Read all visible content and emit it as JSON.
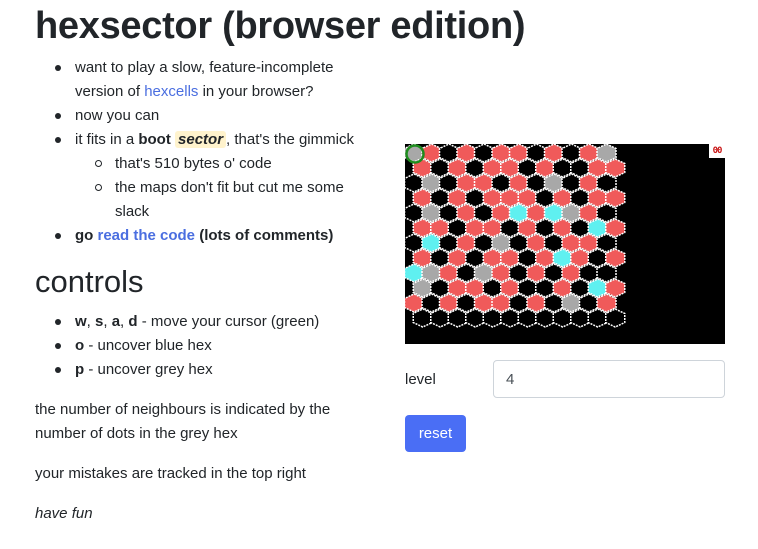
{
  "title": "hexsector (browser edition)",
  "intro": {
    "item1": {
      "before": "want to play a slow, feature-incomplete version of ",
      "link": "hexcells",
      "after": " in your browser?"
    },
    "item2": "now you can",
    "item3": {
      "before": "it fits in a ",
      "bold": "boot",
      "code": "sector",
      "after": ", that's the gimmick",
      "sub": [
        "that's 510 bytes o' code",
        "the maps don't fit but cut me some slack"
      ]
    },
    "item4": {
      "bold1": "go ",
      "link": "read the code",
      "bold2": " (lots of comments)"
    }
  },
  "controls": {
    "heading": "controls",
    "keys_move": {
      "w": "w",
      "s": "s",
      "a": "a",
      "d": "d",
      "sep": ", ",
      "desc": " - move your cursor (green)"
    },
    "key_o": {
      "key": "o",
      "desc": " - uncover blue hex"
    },
    "key_p": {
      "key": "p",
      "desc": " - uncover grey hex"
    }
  },
  "paragraphs": {
    "neighbours": "the number of neighbours is indicated by the number of dots in the grey hex",
    "mistakes": "your mistakes are tracked in the top right",
    "have_fun": "have fun"
  },
  "game": {
    "mistake_counter": "00",
    "colors": {
      "background": "#000000",
      "red": "#f05a5a",
      "black_hex": "#000000",
      "grey": "#a8a8a8",
      "cyan": "#5ff0f0",
      "outline": "#ffffff",
      "cursor": "#1e8c1e"
    },
    "board": [
      "GRKRKRRKRKRG",
      "RKRKRRKRKKRR",
      "KGKRRKRKGKRK",
      "RKRKRRRKRKRR",
      "KGKRKRCRCGRK",
      "RRKRRKRKRKCR",
      "KCKRKGKRKRRK",
      "RKRKRRKRCRKR",
      "CGRKGRKRKRKK",
      "GKRRKRKKRKCR",
      "RKRKRRKRKGKR",
      "KKKKKKKKKKKK"
    ]
  },
  "form": {
    "level_label": "level",
    "level_value": "4",
    "reset_label": "reset"
  }
}
